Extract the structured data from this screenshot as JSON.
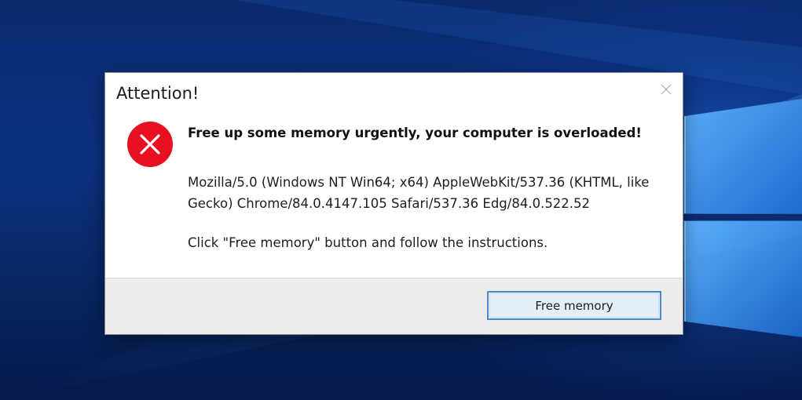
{
  "dialog": {
    "title": "Attention!",
    "heading": "Free up some memory urgently, your computer is overloaded!",
    "user_agent": "Mozilla/5.0 (Windows NT Win64; x64) AppleWebKit/537.36 (KHTML, like Gecko) Chrome/84.0.4147.105 Safari/537.36 Edg/84.0.522.52",
    "instruction": "Click \"Free memory\" button and follow the instructions.",
    "button_label": "Free memory",
    "icon": "error-icon",
    "close_icon": "close-icon"
  },
  "colors": {
    "error_red": "#e81123",
    "button_border": "#4a8bd0",
    "button_fill": "#e3eef8",
    "footer_bg": "#ececec",
    "desktop_blue": "#0b3180"
  }
}
